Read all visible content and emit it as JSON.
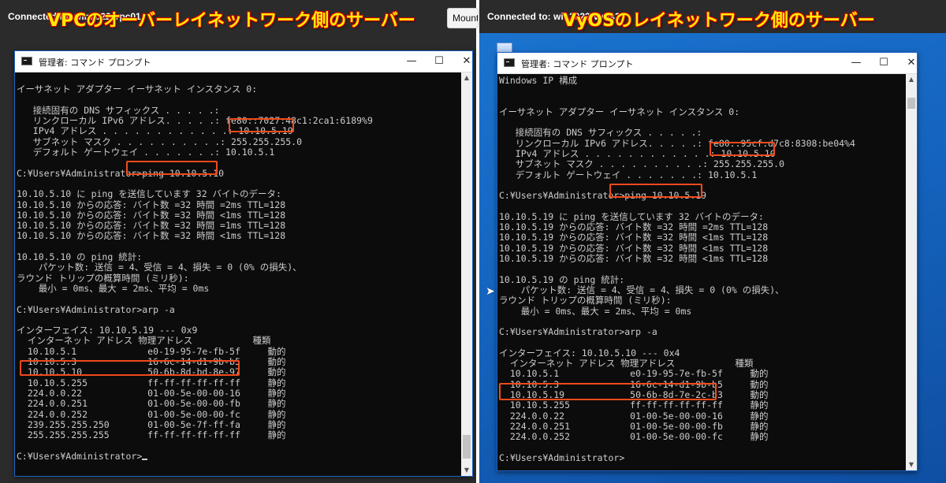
{
  "left": {
    "rdp_title": "Connected to: win2022-vpc01",
    "mount_button": "Mount",
    "caption": "VPCのオーバーレイネットワーク側のサーバー",
    "window_title": "管理者: コマンド プロンプト",
    "controls": {
      "minimize": "—",
      "maximize": "☐",
      "close": "✕"
    },
    "lines": [
      "",
      "イーサネット アダプター イーサネット インスタンス 0:",
      "",
      "   接続固有の DNS サフィックス . . . . .:",
      "   リンクローカル IPv6 アドレス. . . . .: fe80::7027:48c1:2ca1:6189%9",
      "   IPv4 アドレス . . . . . . . . . . . .: 10.10.5.19",
      "   サブネット マスク . . . . . . . . . .: 255.255.255.0",
      "   デフォルト ゲートウェイ . . . . . . .: 10.10.5.1",
      "",
      "C:¥Users¥Administrator>ping 10.10.5.10",
      "",
      "10.10.5.10 に ping を送信しています 32 バイトのデータ:",
      "10.10.5.10 からの応答: バイト数 =32 時間 =2ms TTL=128",
      "10.10.5.10 からの応答: バイト数 =32 時間 <1ms TTL=128",
      "10.10.5.10 からの応答: バイト数 =32 時間 =1ms TTL=128",
      "10.10.5.10 からの応答: バイト数 =32 時間 <1ms TTL=128",
      "",
      "10.10.5.10 の ping 統計:",
      "    パケット数: 送信 = 4、受信 = 4、損失 = 0 (0% の損失)、",
      "ラウンド トリップの概算時間 (ミリ秒):",
      "    最小 = 0ms、最大 = 2ms、平均 = 0ms",
      "",
      "C:¥Users¥Administrator>arp -a",
      "",
      "インターフェイス: 10.10.5.19 --- 0x9",
      "  インターネット アドレス 物理アドレス           種類",
      "  10.10.5.1             e0-19-95-7e-fb-5f     動的",
      "  10.10.5.3             16-6c-14-d1-9b-b5     動的",
      "  10.10.5.10            50-6b-8d-bd-8e-97     動的",
      "  10.10.5.255           ff-ff-ff-ff-ff-ff     静的",
      "  224.0.0.22            01-00-5e-00-00-16     静的",
      "  224.0.0.251           01-00-5e-00-00-fb     静的",
      "  224.0.0.252           01-00-5e-00-00-fc     静的",
      "  239.255.255.250       01-00-5e-7f-ff-fa     静的",
      "  255.255.255.255       ff-ff-ff-ff-ff-ff     静的",
      "",
      "C:¥Users¥Administrator>"
    ]
  },
  "right": {
    "rdp_title": "Connected to: win2022-vyos2",
    "caption": "VyOSのレイネットワーク側のサーバー",
    "window_title": "管理者: コマンド プロンプト",
    "controls": {
      "minimize": "—",
      "maximize": "☐",
      "close": "✕"
    },
    "lines": [
      "Windows IP 構成",
      "",
      "",
      "イーサネット アダプター イーサネット インスタンス 0:",
      "",
      "   接続固有の DNS サフィックス . . . . .:",
      "   リンクローカル IPv6 アドレス. . . . .: fe80::95cf:d7c8:8308:be04%4",
      "   IPv4 アドレス . . . . . . . . . . . .: 10.10.5.10",
      "   サブネット マスク . . . . . . . . . .: 255.255.255.0",
      "   デフォルト ゲートウェイ . . . . . . .: 10.10.5.1",
      "",
      "C:¥Users¥Administrator>ping 10.10.5.19",
      "",
      "10.10.5.19 に ping を送信しています 32 バイトのデータ:",
      "10.10.5.19 からの応答: バイト数 =32 時間 =2ms TTL=128",
      "10.10.5.19 からの応答: バイト数 =32 時間 <1ms TTL=128",
      "10.10.5.19 からの応答: バイト数 =32 時間 <1ms TTL=128",
      "10.10.5.19 からの応答: バイト数 =32 時間 <1ms TTL=128",
      "",
      "10.10.5.19 の ping 統計:",
      "    パケット数: 送信 = 4、受信 = 4、損失 = 0 (0% の損失)、",
      "ラウンド トリップの概算時間 (ミリ秒):",
      "    最小 = 0ms、最大 = 2ms、平均 = 0ms",
      "",
      "C:¥Users¥Administrator>arp -a",
      "",
      "インターフェイス: 10.10.5.10 --- 0x4",
      "  インターネット アドレス 物理アドレス           種類",
      "  10.10.5.1             e0-19-95-7e-fb-5f     動的",
      "  10.10.5.3             16-6c-14-d1-9b-b5     動的",
      "  10.10.5.19            50-6b-8d-7e-2c-b3     動的",
      "  10.10.5.255           ff-ff-ff-ff-ff-ff     静的",
      "  224.0.0.22            01-00-5e-00-00-16     静的",
      "  224.0.0.251           01-00-5e-00-00-fb     静的",
      "  224.0.0.252           01-00-5e-00-00-fc     静的",
      "",
      "C:¥Users¥Administrator>"
    ]
  },
  "colors": {
    "console_bg": "#0c0c0c",
    "console_text": "#cccccc",
    "highlight": "#f04a1b",
    "caption": "#ffec00",
    "desktop": "#1565c0"
  }
}
